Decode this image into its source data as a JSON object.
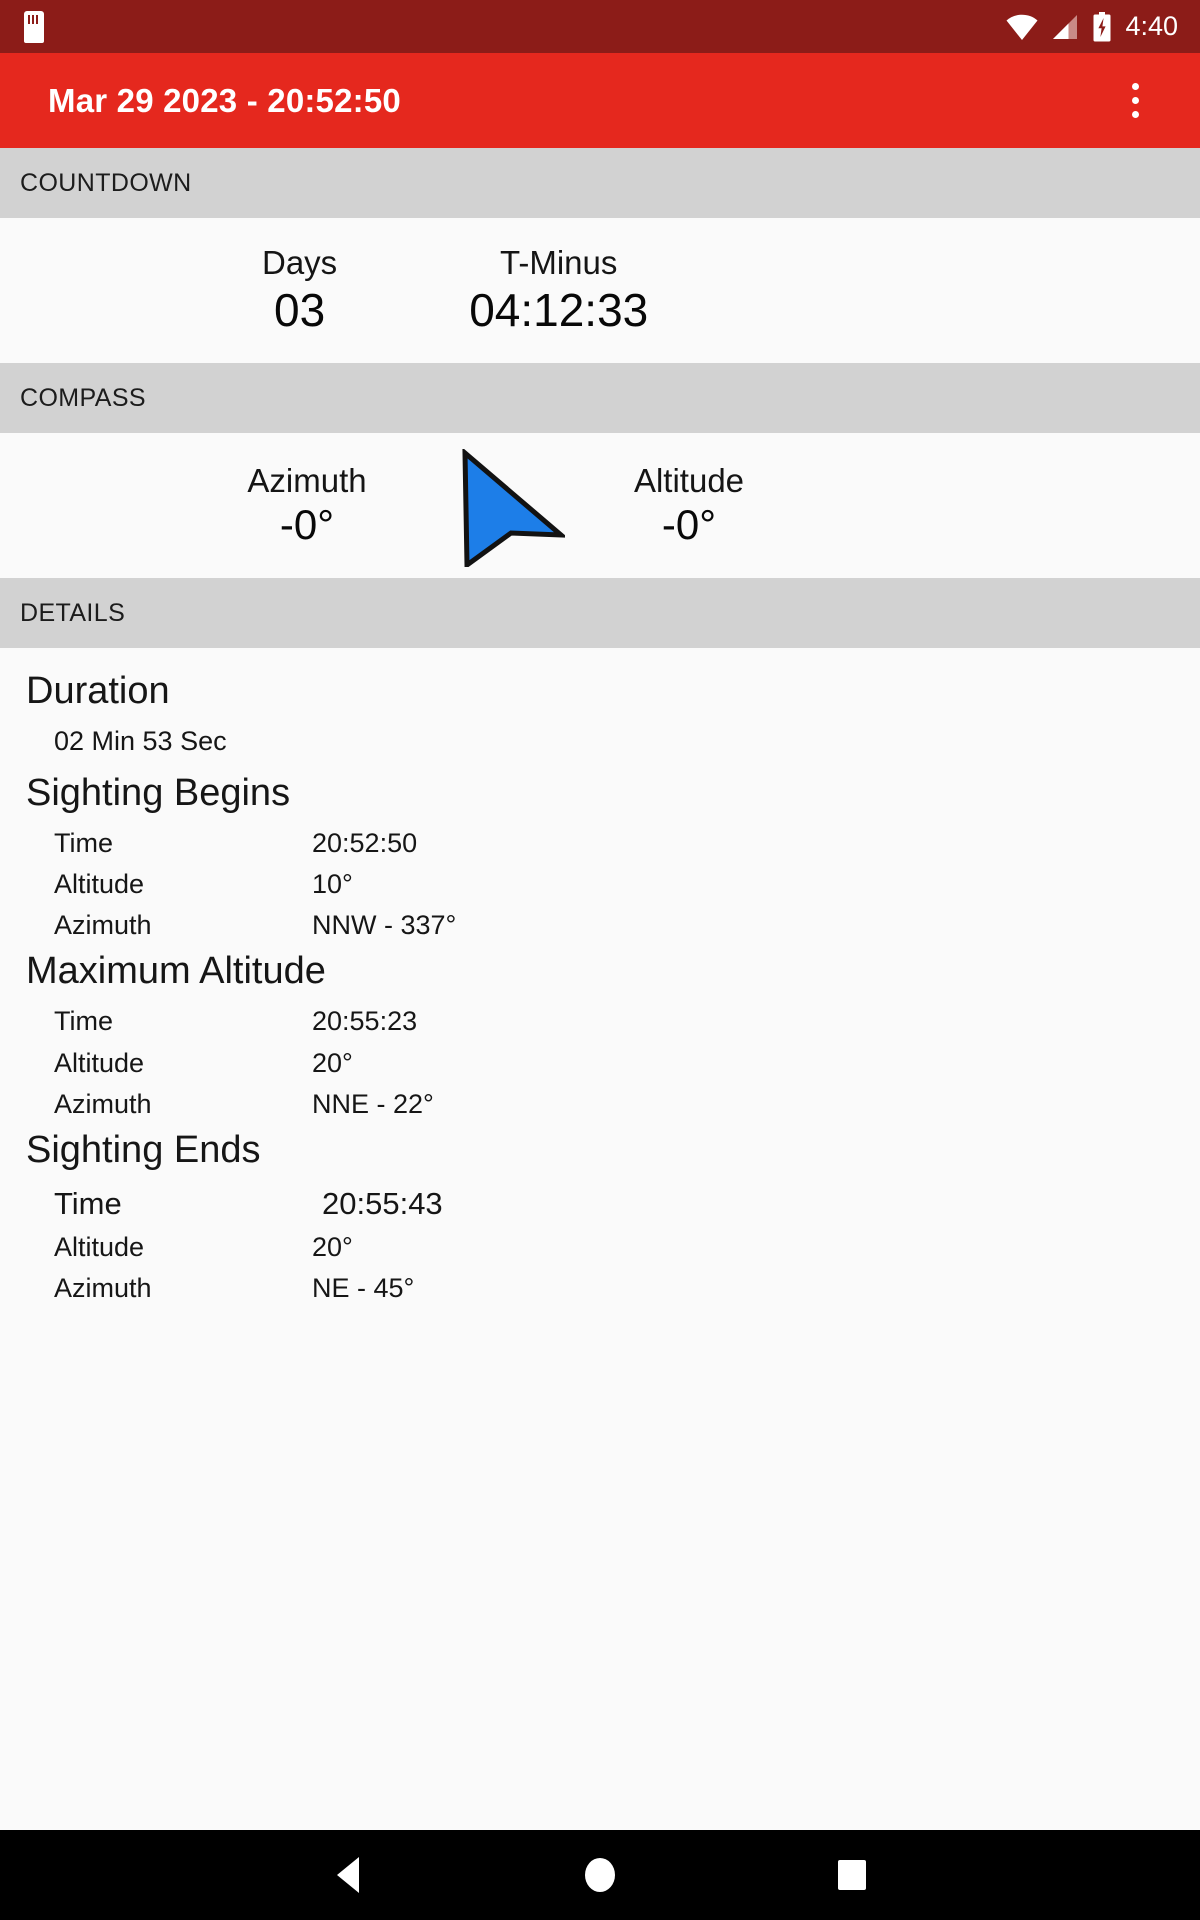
{
  "status_bar": {
    "sd_card_icon": "sd-card-icon",
    "wifi_icon": "wifi-icon",
    "signal_icon": "cellular-signal-icon",
    "battery_icon": "battery-charging-icon",
    "time": "4:40",
    "background_color": "#8c1c18"
  },
  "app_bar": {
    "title": "Mar 29 2023 - 20:52:50",
    "overflow_icon": "overflow-menu-icon",
    "background_color": "#e5281e"
  },
  "sections": {
    "countdown": {
      "header": "COUNTDOWN",
      "days_label": "Days",
      "days_value": "03",
      "tminus_label": "T-Minus",
      "tminus_value": "04:12:33"
    },
    "compass": {
      "header": "COMPASS",
      "azimuth_label": "Azimuth",
      "azimuth_value": "-0°",
      "altitude_label": "Altitude",
      "altitude_value": "-0°",
      "arrow_icon": "navigation-arrow-icon",
      "arrow_color": "#1d7ee8"
    },
    "details": {
      "header": "DETAILS",
      "duration": {
        "title": "Duration",
        "value": "02 Min 53 Sec"
      },
      "sighting_begins": {
        "title": "Sighting Begins",
        "rows": [
          {
            "key": "Time",
            "value": "20:52:50"
          },
          {
            "key": "Altitude",
            "value": "10°"
          },
          {
            "key": "Azimuth",
            "value": "NNW - 337°"
          }
        ]
      },
      "maximum_altitude": {
        "title": "Maximum Altitude",
        "rows": [
          {
            "key": "Time",
            "value": "20:55:23"
          },
          {
            "key": "Altitude",
            "value": "20°"
          },
          {
            "key": "Azimuth",
            "value": "NNE -  22°"
          }
        ]
      },
      "sighting_ends": {
        "title": "Sighting Ends",
        "rows": [
          {
            "key": "Time",
            "value": "20:55:43"
          },
          {
            "key": "Altitude",
            "value": "20°"
          },
          {
            "key": "Azimuth",
            "value": "NE -  45°"
          }
        ]
      }
    }
  },
  "nav_bar": {
    "back_icon": "back-triangle-icon",
    "home_icon": "home-circle-icon",
    "recents_icon": "recents-square-icon"
  }
}
